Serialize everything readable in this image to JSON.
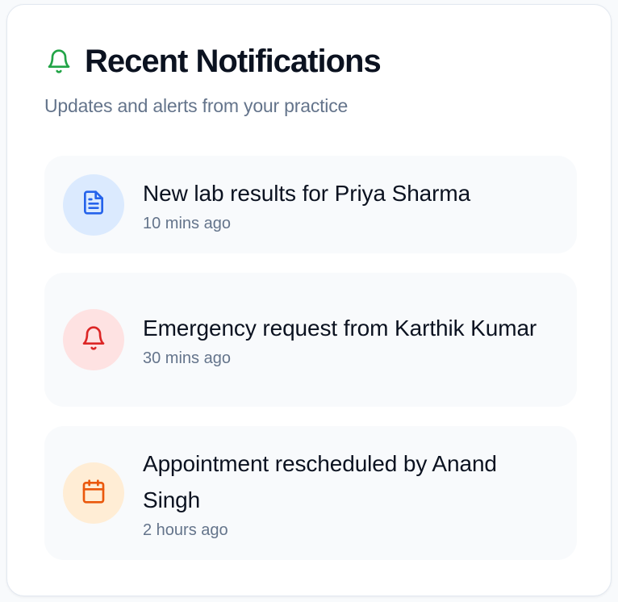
{
  "header": {
    "title": "Recent Notifications",
    "subtitle": "Updates and alerts from your practice",
    "icon": "bell-icon",
    "icon_color": "#22a447"
  },
  "notifications": [
    {
      "title": "New lab results for Priya Sharma",
      "time": "10 mins ago",
      "icon": "document-icon",
      "icon_color": "#2563eb",
      "icon_bg": "#dbeafe"
    },
    {
      "title": "Emergency request from Karthik Kumar",
      "time": "30 mins ago",
      "icon": "bell-icon",
      "icon_color": "#dc2626",
      "icon_bg": "#fee2e2"
    },
    {
      "title": "Appointment rescheduled by Anand Singh",
      "time": "2 hours ago",
      "icon": "calendar-icon",
      "icon_color": "#ea580c",
      "icon_bg": "#ffedd5"
    }
  ]
}
